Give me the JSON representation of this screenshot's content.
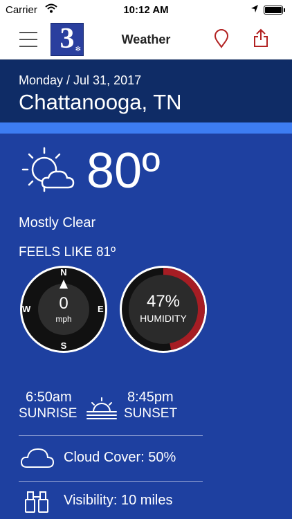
{
  "status_bar": {
    "carrier": "Carrier",
    "time": "10:12 AM",
    "icons": [
      "wifi-icon",
      "location-arrow-icon",
      "battery-icon"
    ]
  },
  "nav": {
    "logo_text": "3",
    "title": "Weather",
    "icons": [
      "hamburger-menu-icon",
      "map-pin-icon",
      "share-icon"
    ],
    "accent_color": "#b22222"
  },
  "header": {
    "date": "Monday / Jul 31, 2017",
    "city": "Chattanooga, TN"
  },
  "current": {
    "icon": "partly-cloudy-icon",
    "temperature": "80º",
    "condition": "Mostly Clear",
    "feels_like": "FEELS LIKE 81º"
  },
  "wind": {
    "speed": "0",
    "unit": "mph",
    "compass": {
      "n": "N",
      "s": "S",
      "e": "E",
      "w": "W"
    }
  },
  "humidity": {
    "value_text": "47%",
    "label": "HUMIDITY",
    "fraction": 0.47
  },
  "sun": {
    "sunrise_time": "6:50am",
    "sunrise_label": "SUNRISE",
    "sunset_time": "8:45pm",
    "sunset_label": "SUNSET"
  },
  "details": {
    "cloud_cover": "Cloud Cover: 50%",
    "visibility": "Visibility: 10 miles"
  },
  "colors": {
    "background": "#1e40a0",
    "header": "#0f2c66",
    "accent_bar": "#3d7df2",
    "humidity_arc": "#a61d24"
  }
}
